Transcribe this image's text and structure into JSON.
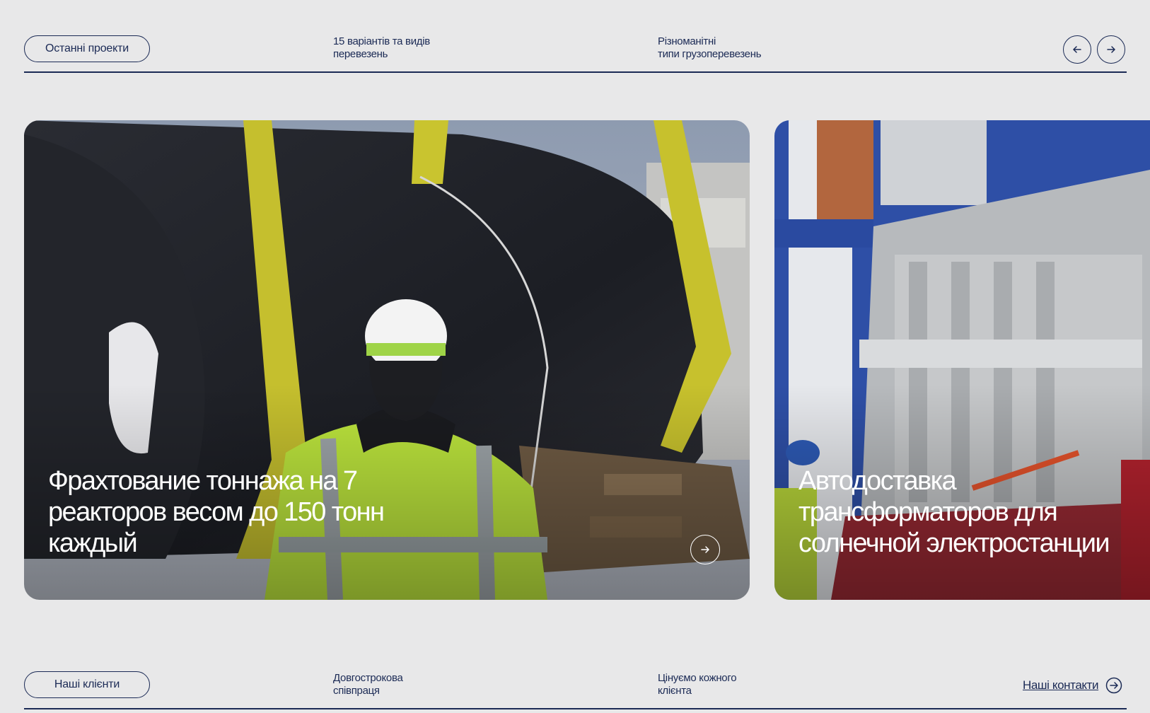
{
  "top": {
    "pill_label": "Останні проекти",
    "meta1": "15 варіантів та видів\nперевезень",
    "meta2": "Різноманітні\nтипи грузоперевезень",
    "prev_icon": "arrow-left-icon",
    "next_icon": "arrow-right-icon"
  },
  "cards": [
    {
      "title": "Фрахтование тоннажа на 7\nреакторов весом до 150 тонн\nкаждый",
      "arrow_icon": "arrow-right-icon"
    },
    {
      "title": "Автодоставка\nтрансформаторов для\nсолнечной электростанции"
    }
  ],
  "bottom": {
    "pill_label": "Наші клієнти",
    "meta1": "Довгострокова\nспівпраця",
    "meta2": "Цінуємо кожного\nклієнта",
    "contacts_label": "Наші контакти",
    "contacts_icon": "arrow-right-circle-icon"
  },
  "colors": {
    "background": "#e8e8e9",
    "primary": "#1b2a55",
    "card_text": "#ffffff"
  }
}
